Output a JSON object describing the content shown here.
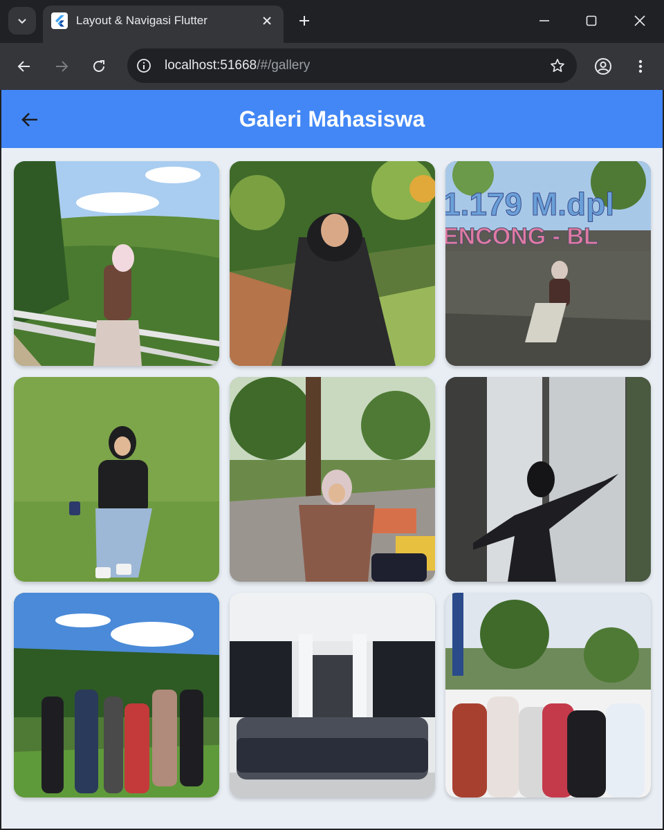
{
  "browser": {
    "tab_title": "Layout & Navigasi Flutter",
    "url_host": "localhost:51668",
    "url_path": "/#/gallery"
  },
  "appbar": {
    "title": "Galeri Mahasiswa"
  },
  "icons": {
    "back": "arrow-left-icon",
    "favicon": "flutter-logo-icon"
  },
  "colors": {
    "appbar": "#4287f5",
    "background": "#e9eef5",
    "browser_frame": "#202124"
  },
  "photos": [
    {
      "sign_text": ""
    },
    {
      "sign_text": ""
    },
    {
      "sign_text": "1.179 M dpl / ENCONG - BL"
    },
    {
      "sign_text": ""
    },
    {
      "sign_text": ""
    },
    {
      "sign_text": ""
    },
    {
      "sign_text": ""
    },
    {
      "sign_text": ""
    },
    {
      "sign_text": ""
    }
  ]
}
